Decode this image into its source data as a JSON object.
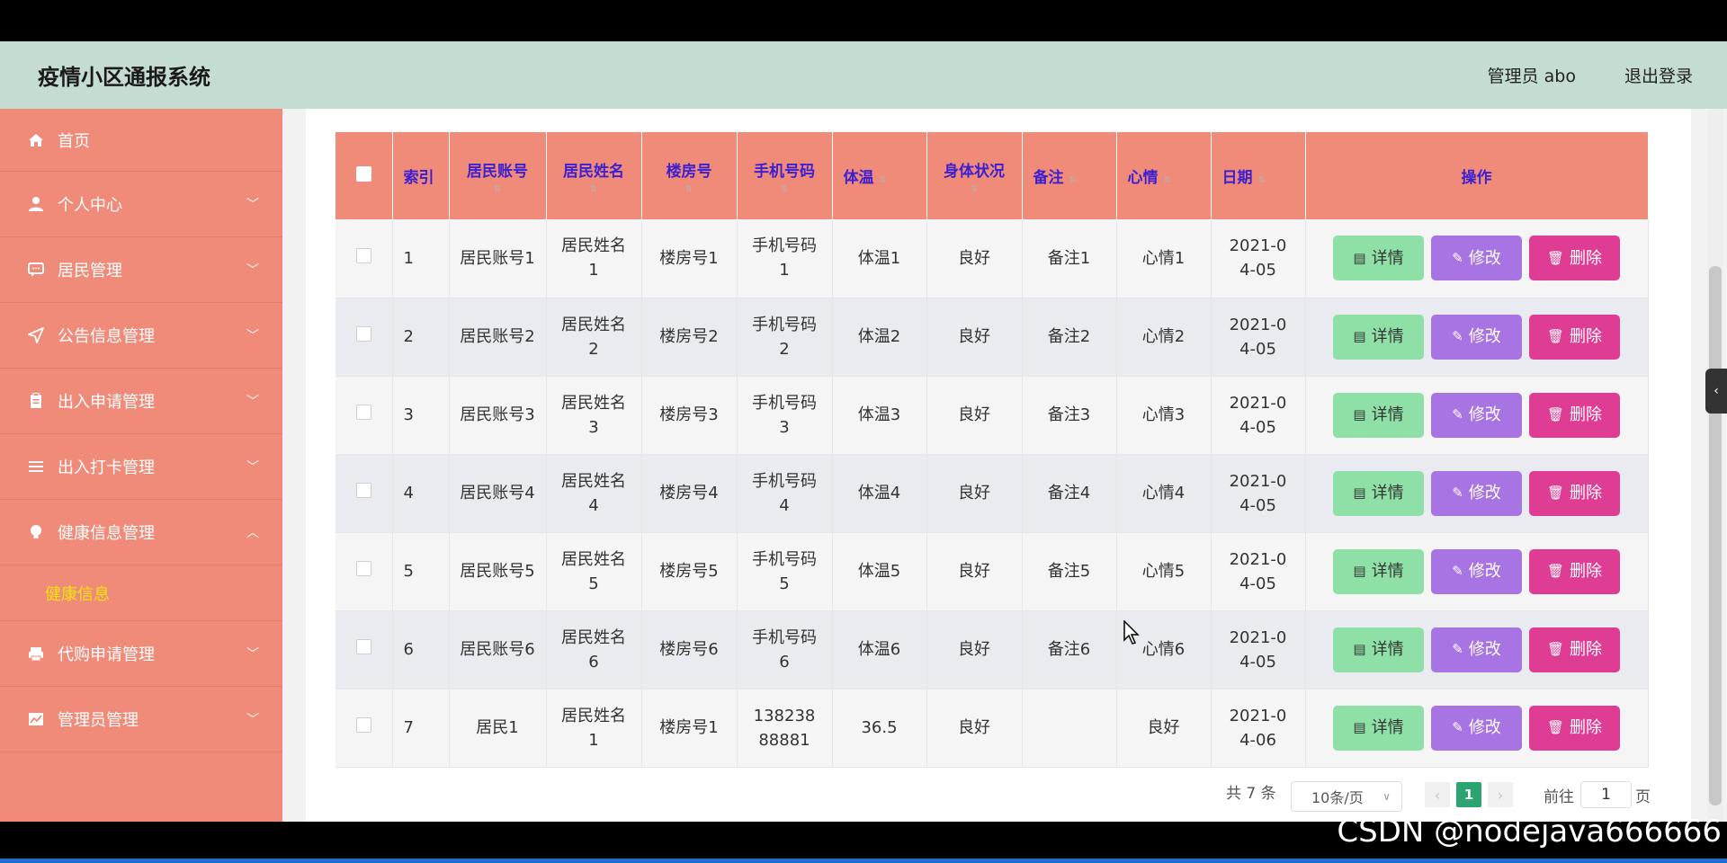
{
  "header": {
    "title": "疫情小区通报系统",
    "admin_label": "管理员 abo",
    "logout_label": "退出登录"
  },
  "sidebar": {
    "items": [
      {
        "label": "首页",
        "icon": "home-icon"
      },
      {
        "label": "个人中心",
        "icon": "user-icon"
      },
      {
        "label": "居民管理",
        "icon": "chat-icon"
      },
      {
        "label": "公告信息管理",
        "icon": "send-icon"
      },
      {
        "label": "出入申请管理",
        "icon": "clipboard-icon"
      },
      {
        "label": "出入打卡管理",
        "icon": "list-icon"
      },
      {
        "label": "健康信息管理",
        "icon": "bulb-icon"
      },
      {
        "label": "代购申请管理",
        "icon": "printer-icon"
      },
      {
        "label": "管理员管理",
        "icon": "chart-icon"
      }
    ],
    "sub_item": "健康信息"
  },
  "table": {
    "headers": [
      "索引",
      "居民账号",
      "居民姓名",
      "楼房号",
      "手机号码",
      "体温",
      "身体状况",
      "备注",
      "心情",
      "日期",
      "操作"
    ],
    "rows": [
      {
        "idx": "1",
        "account": "居民账号1",
        "name": "居民姓名1",
        "building": "楼房号1",
        "phone": "手机号码1",
        "temp": "体温1",
        "status": "良好",
        "note": "备注1",
        "mood": "心情1",
        "date": "2021-04-05"
      },
      {
        "idx": "2",
        "account": "居民账号2",
        "name": "居民姓名2",
        "building": "楼房号2",
        "phone": "手机号码2",
        "temp": "体温2",
        "status": "良好",
        "note": "备注2",
        "mood": "心情2",
        "date": "2021-04-05"
      },
      {
        "idx": "3",
        "account": "居民账号3",
        "name": "居民姓名3",
        "building": "楼房号3",
        "phone": "手机号码3",
        "temp": "体温3",
        "status": "良好",
        "note": "备注3",
        "mood": "心情3",
        "date": "2021-04-05"
      },
      {
        "idx": "4",
        "account": "居民账号4",
        "name": "居民姓名4",
        "building": "楼房号4",
        "phone": "手机号码4",
        "temp": "体温4",
        "status": "良好",
        "note": "备注4",
        "mood": "心情4",
        "date": "2021-04-05"
      },
      {
        "idx": "5",
        "account": "居民账号5",
        "name": "居民姓名5",
        "building": "楼房号5",
        "phone": "手机号码5",
        "temp": "体温5",
        "status": "良好",
        "note": "备注5",
        "mood": "心情5",
        "date": "2021-04-05"
      },
      {
        "idx": "6",
        "account": "居民账号6",
        "name": "居民姓名6",
        "building": "楼房号6",
        "phone": "手机号码6",
        "temp": "体温6",
        "status": "良好",
        "note": "备注6",
        "mood": "心情6",
        "date": "2021-04-05"
      },
      {
        "idx": "7",
        "account": "居民1",
        "name": "居民姓名1",
        "building": "楼房号1",
        "phone": "13823888881",
        "temp": "36.5",
        "status": "良好",
        "note": "",
        "mood": "良好",
        "date": "2021-04-06"
      }
    ],
    "actions": {
      "detail": "详情",
      "edit": "修改",
      "delete": "删除"
    }
  },
  "pagination": {
    "total": "共 7 条",
    "page_size": "10条/页",
    "prev": "‹",
    "next": "›",
    "current": "1",
    "goto_label": "前往",
    "goto_value": "1",
    "page_suffix": "页"
  },
  "watermark": "CSDN @nodejava666666",
  "colors": {
    "header_bg": "#c5dcd3",
    "sidebar_bg": "#f08b7a",
    "table_header_bg": "#f08b7a",
    "header_text": "#3b1fd1",
    "sub_item": "#f5e50b",
    "detail_btn": "#8ee0a6",
    "edit_btn": "#a874e3",
    "delete_btn": "#df3d94",
    "page_active": "#2ca471"
  }
}
